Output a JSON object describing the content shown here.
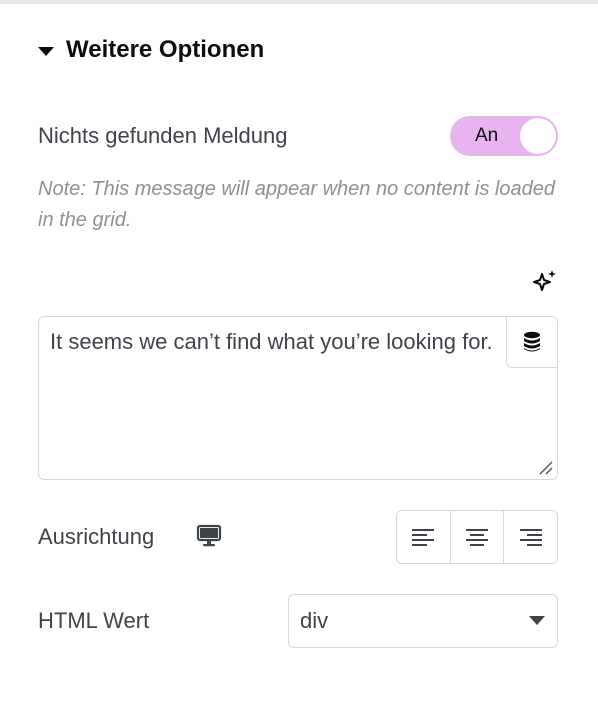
{
  "section": {
    "title": "Weitere Optionen"
  },
  "no_results": {
    "label": "Nichts gefunden Meldung",
    "toggle_label": "An",
    "toggle_state": "on",
    "toggle_color": "#e8b4f0",
    "note": "Note: This message will appear when no content is loaded in the grid.",
    "ai_icon": "sparkle-icon",
    "message_value": "It seems we can’t find what you’re looking for.",
    "dynamic_icon": "database-icon"
  },
  "alignment": {
    "label": "Ausrichtung",
    "device_icon": "desktop-icon",
    "options": [
      "align-left-icon",
      "align-center-icon",
      "align-right-icon"
    ]
  },
  "html_tag": {
    "label": "HTML Wert",
    "selected": "div"
  }
}
